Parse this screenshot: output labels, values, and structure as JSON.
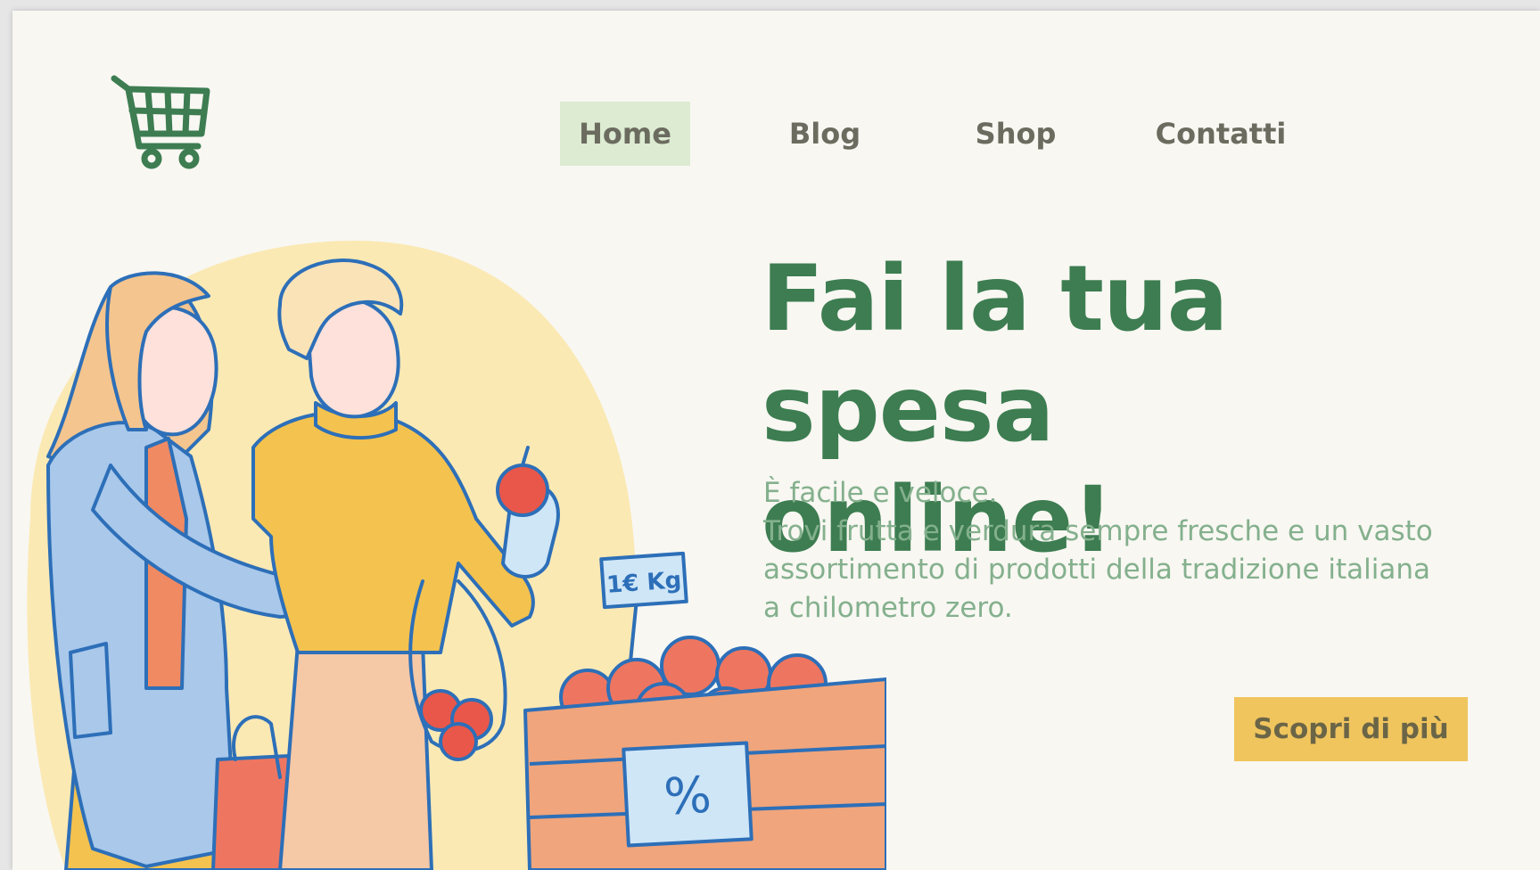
{
  "logo": {
    "icon": "shopping-cart-icon",
    "color": "#3d7d51"
  },
  "nav": {
    "items": [
      {
        "label": "Home",
        "active": true
      },
      {
        "label": "Blog",
        "active": false
      },
      {
        "label": "Shop",
        "active": false
      },
      {
        "label": "Contatti",
        "active": false
      }
    ]
  },
  "hero": {
    "title_line1": "Fai la tua spesa",
    "title_line2": "online!",
    "text_line1": "È facile e veloce.",
    "text_line2": "Trovi frutta e verdura sempre fresche e un vasto",
    "text_line3": "assortimento di prodotti della tradizione italiana",
    "text_line4": "a chilometro zero.",
    "cta_label": "Scopri di più"
  },
  "illustration": {
    "price_tag": "1€ Kg",
    "crate_label": "%"
  },
  "colors": {
    "brand_green": "#3d7d51",
    "active_nav_bg": "#dcebd2",
    "cta_bg": "#f0c55e",
    "background": "#f8f7f2"
  }
}
